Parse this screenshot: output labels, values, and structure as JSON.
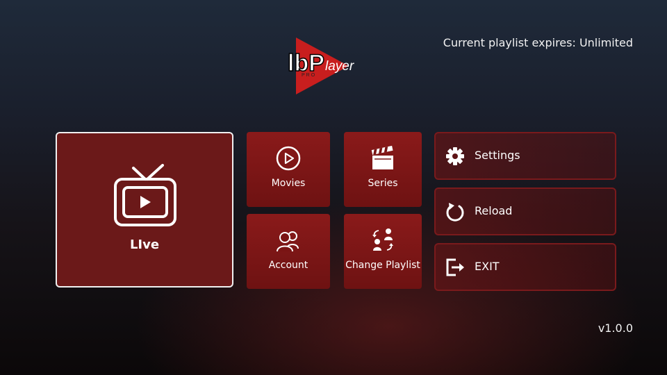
{
  "header": {
    "logo_text": "IbPlayer",
    "logo_sub": "PRO",
    "expiry_text": "Current playlist expires: Unlimited"
  },
  "tiles": {
    "live": {
      "label": "LIve",
      "icon": "tv-icon"
    },
    "movies": {
      "label": "Movies",
      "icon": "play-circle-icon"
    },
    "series": {
      "label": "Series",
      "icon": "clapperboard-icon"
    },
    "account": {
      "label": "Account",
      "icon": "users-icon"
    },
    "change_playlist": {
      "label": "Change Playlist",
      "icon": "switch-users-icon"
    }
  },
  "menu": {
    "settings": {
      "label": "Settings",
      "icon": "gear-icon"
    },
    "reload": {
      "label": "Reload",
      "icon": "reload-icon"
    },
    "exit": {
      "label": "EXIT",
      "icon": "exit-icon"
    }
  },
  "footer": {
    "version": "v1.0.0"
  },
  "colors": {
    "accent": "#8a1a1a",
    "focus_border": "#f0f0f0",
    "logo_red": "#c81e1e"
  }
}
